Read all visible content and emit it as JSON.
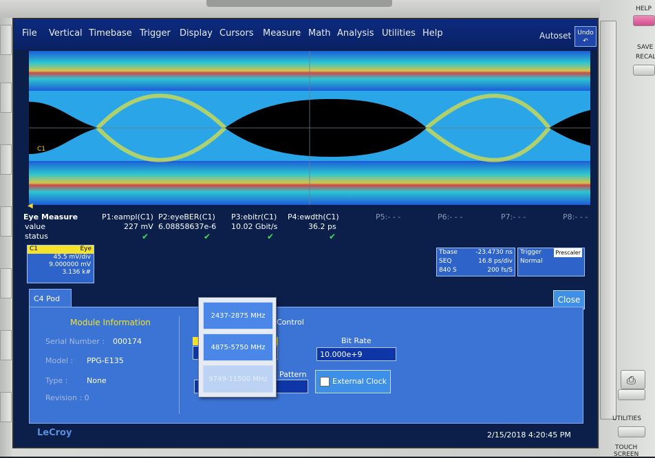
{
  "menu": {
    "items": [
      "File",
      "Vertical",
      "Timebase",
      "Trigger",
      "Display",
      "Cursors",
      "Measure",
      "Math",
      "Analysis",
      "Utilities",
      "Help"
    ],
    "autoset": "Autoset",
    "undo": "Undo"
  },
  "channel_marker": "C1",
  "measurements": {
    "title": "Eye Measure",
    "row_value": "value",
    "row_status": "status",
    "columns": [
      {
        "label": "P1:eampl(C1)",
        "value": "227 mV"
      },
      {
        "label": "P2:eyeBER(C1)",
        "value": "6.08858637e-6"
      },
      {
        "label": "P3:ebitr(C1)",
        "value": "10.02 Gbit/s"
      },
      {
        "label": "P4:ewdth(C1)",
        "value": "36.2 ps"
      },
      {
        "label": "P5:- - -",
        "value": ""
      },
      {
        "label": "P6:- - -",
        "value": ""
      },
      {
        "label": "P7:- - -",
        "value": ""
      },
      {
        "label": "P8:- - -",
        "value": ""
      }
    ]
  },
  "c1_box": {
    "label": "C1",
    "tag": "Eye",
    "l1": "45.5 mV/div",
    "l2": "9.000000 mV",
    "l3": "3.136 k#"
  },
  "tbase": {
    "label": "Tbase",
    "offset": "-23.4730 ns",
    "mode": "SEQ",
    "rate": "16.8 ps/div",
    "count": "840 S",
    "samp": "200 fs/S"
  },
  "trigger": {
    "label": "Trigger",
    "badge": "Prescaler",
    "mode": "Normal"
  },
  "panel": {
    "tab": "C4 Pod",
    "close": "Close",
    "module_info_title": "Module Information",
    "serial_label": "Serial Number :",
    "serial_value": "000174",
    "model_label": "Model :",
    "model_value": "PPG-E135",
    "type_label": "Type :",
    "type_value": "None",
    "revision_label": "Revision : 0",
    "control_label": "Control",
    "bit_rate_label": "Bit Rate",
    "bit_rate_value": "10.000e+9",
    "pattern_label": "Pattern",
    "external_clock": "External Clock"
  },
  "dropdown_options": [
    "2437-2875 MHz",
    "4875-5750 MHz",
    "9749-11500 MHz"
  ],
  "brand": "LeCroy",
  "datetime": "2/15/2018 4:20:45 PM",
  "side_labels": {
    "help": "HELP",
    "save": "SAVE",
    "recall": "RECAL",
    "utilities": "UTILITIES",
    "touch": "TOUCH",
    "screen": "SCREEN"
  }
}
